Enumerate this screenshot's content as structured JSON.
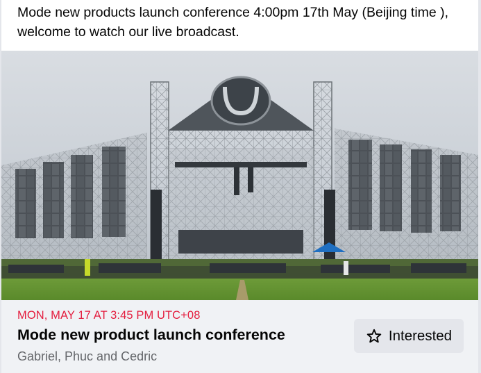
{
  "post": {
    "text": "Mode new products launch conference 4:00pm 17th May (Beijing time ), welcome to watch our live broadcast."
  },
  "event": {
    "date": "MON, MAY 17 AT 3:45 PM UTC+08",
    "title": "Mode new product launch conference",
    "hosts": "Gabriel, Phuc and Cedric",
    "interested_label": "Interested",
    "interested_icon": "star-outline-icon"
  },
  "colors": {
    "date_red": "#e41e3f",
    "hosts_gray": "#65676b",
    "event_bar_bg": "#f0f2f5",
    "button_bg": "#e4e6eb"
  }
}
